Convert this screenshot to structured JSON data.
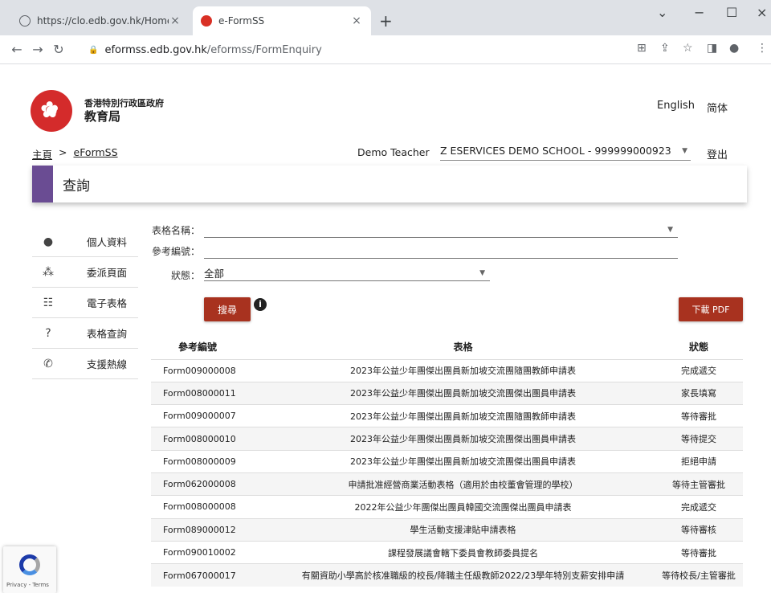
{
  "browser": {
    "tabs": [
      {
        "title": "https://clo.edb.gov.hk/Home/I",
        "close": "×"
      },
      {
        "title": "e-FormSS",
        "close": "×"
      }
    ],
    "new_tab": "+",
    "window": {
      "minimize": "−",
      "maximize": "☐",
      "close": "×",
      "menu": "⌄"
    },
    "nav": {
      "back": "←",
      "forward": "→",
      "reload": "↻"
    },
    "url_host": "eformss.edb.gov.hk",
    "url_path": "/eformss/FormEnquiry",
    "toolbar_icons": [
      "translate-icon",
      "share-icon",
      "star-icon",
      "sidebar-icon",
      "profile-icon",
      "menu-icon"
    ]
  },
  "header": {
    "org_line1": "香港特別行政區政府",
    "org_line2": "教育局",
    "lang_en": "English",
    "lang_sc": "简体"
  },
  "breadcrumb": {
    "home": "主頁",
    "sep": ">",
    "current": "eFormSS"
  },
  "user": {
    "name": "Demo Teacher",
    "school": "Z ESERVICES DEMO SCHOOL - 999999000923",
    "logout": "登出"
  },
  "page_title": "查詢",
  "sidebar": {
    "items": [
      {
        "label": "個人資料",
        "icon": "person-icon"
      },
      {
        "label": "委派頁面",
        "icon": "group-icon"
      },
      {
        "label": "電子表格",
        "icon": "list-icon"
      },
      {
        "label": "表格查詢",
        "icon": "help-icon"
      },
      {
        "label": "支援熱線",
        "icon": "phone-icon"
      }
    ]
  },
  "form": {
    "form_name_label": "表格名稱：",
    "ref_label": "參考編號：",
    "status_label": "狀態：",
    "status_value": "全部",
    "search_button": "搜尋",
    "info": "i",
    "pdf_button": "下載 PDF"
  },
  "table": {
    "headers": {
      "ref": "參考編號",
      "form": "表格",
      "status": "狀態"
    },
    "rows": [
      {
        "ref": "Form009000008",
        "form": "2023年公益少年團傑出團員新加坡交流團隨團教師申請表",
        "status": "完成遞交"
      },
      {
        "ref": "Form008000011",
        "form": "2023年公益少年團傑出團員新加坡交流團傑出團員申請表",
        "status": "家長填寫"
      },
      {
        "ref": "Form009000007",
        "form": "2023年公益少年團傑出團員新加坡交流團隨團教師申請表",
        "status": "等待審批"
      },
      {
        "ref": "Form008000010",
        "form": "2023年公益少年團傑出團員新加坡交流團傑出團員申請表",
        "status": "等待提交"
      },
      {
        "ref": "Form008000009",
        "form": "2023年公益少年團傑出團員新加坡交流團傑出團員申請表",
        "status": "拒絕申請"
      },
      {
        "ref": "Form062000008",
        "form": "申請批准經營商業活動表格（適用於由校董會管理的學校）",
        "status": "等待主管審批"
      },
      {
        "ref": "Form008000008",
        "form": "2022年公益少年團傑出團員韓國交流團傑出團員申請表",
        "status": "完成遞交"
      },
      {
        "ref": "Form089000012",
        "form": "學生活動支援津貼申請表格",
        "status": "等待審核"
      },
      {
        "ref": "Form090010002",
        "form": "課程發展議會轄下委員會教師委員提名",
        "status": "等待審批"
      },
      {
        "ref": "Form067000017",
        "form": "有關資助小學高於核准職級的校長/降職主任級教師2022/23學年特別支薪安排申請",
        "status": "等待校長/主管審批"
      }
    ]
  },
  "recaptcha": {
    "text": "Privacy - Terms"
  }
}
